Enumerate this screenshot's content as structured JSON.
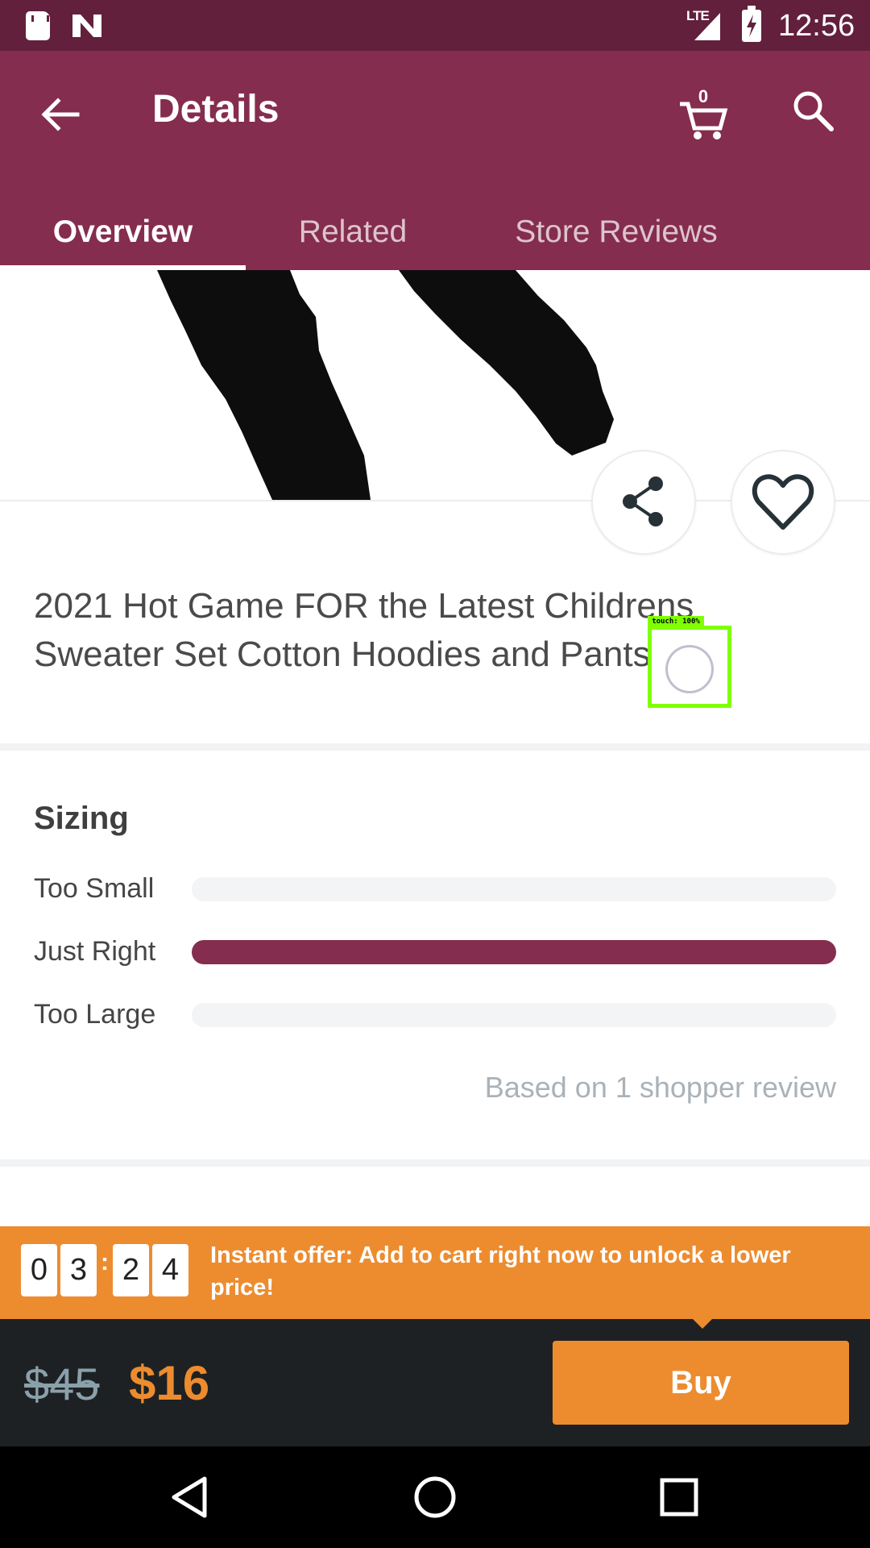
{
  "status_bar": {
    "network": "LTE",
    "time": "12:56",
    "icons": [
      "sd-card-icon",
      "n-notification-icon",
      "signal-icon",
      "battery-charging-icon"
    ]
  },
  "header": {
    "title": "Details",
    "cart_count": "0",
    "icons": [
      "back-arrow-icon",
      "cart-icon",
      "search-icon"
    ]
  },
  "tabs": [
    {
      "label": "Overview",
      "active": true
    },
    {
      "label": "Related",
      "active": false
    },
    {
      "label": "Store Reviews",
      "active": false
    }
  ],
  "product": {
    "title": "2021 Hot Game FOR the Latest Childrens Sweater Set Cotton Hoodies and Pants",
    "image": "black-pants-image"
  },
  "actions": {
    "icons": [
      "share-icon",
      "heart-icon"
    ]
  },
  "touch_indicator": {
    "label": "touch: 100%"
  },
  "sizing": {
    "title": "Sizing",
    "rows": [
      {
        "label": "Too Small",
        "fraction": 0.0
      },
      {
        "label": "Just Right",
        "fraction": 1.0
      },
      {
        "label": "Too Large",
        "fraction": 0.0
      }
    ],
    "footer": "Based on 1 shopper review"
  },
  "offer": {
    "countdown": [
      "0",
      "3",
      "2",
      "4"
    ],
    "separator": ":",
    "text": "Instant offer: Add to cart right now to unlock a lower price!"
  },
  "buy_bar": {
    "old_price": "$45",
    "new_price": "$16",
    "buy_label": "Buy"
  },
  "colors": {
    "brand": "#852d4e",
    "status_bar": "#62203c",
    "accent": "#ed8c2f",
    "buy_bar_bg": "#1e2123"
  },
  "nav_bar": {
    "icons": [
      "back-triangle-icon",
      "home-circle-icon",
      "recents-square-icon"
    ]
  }
}
